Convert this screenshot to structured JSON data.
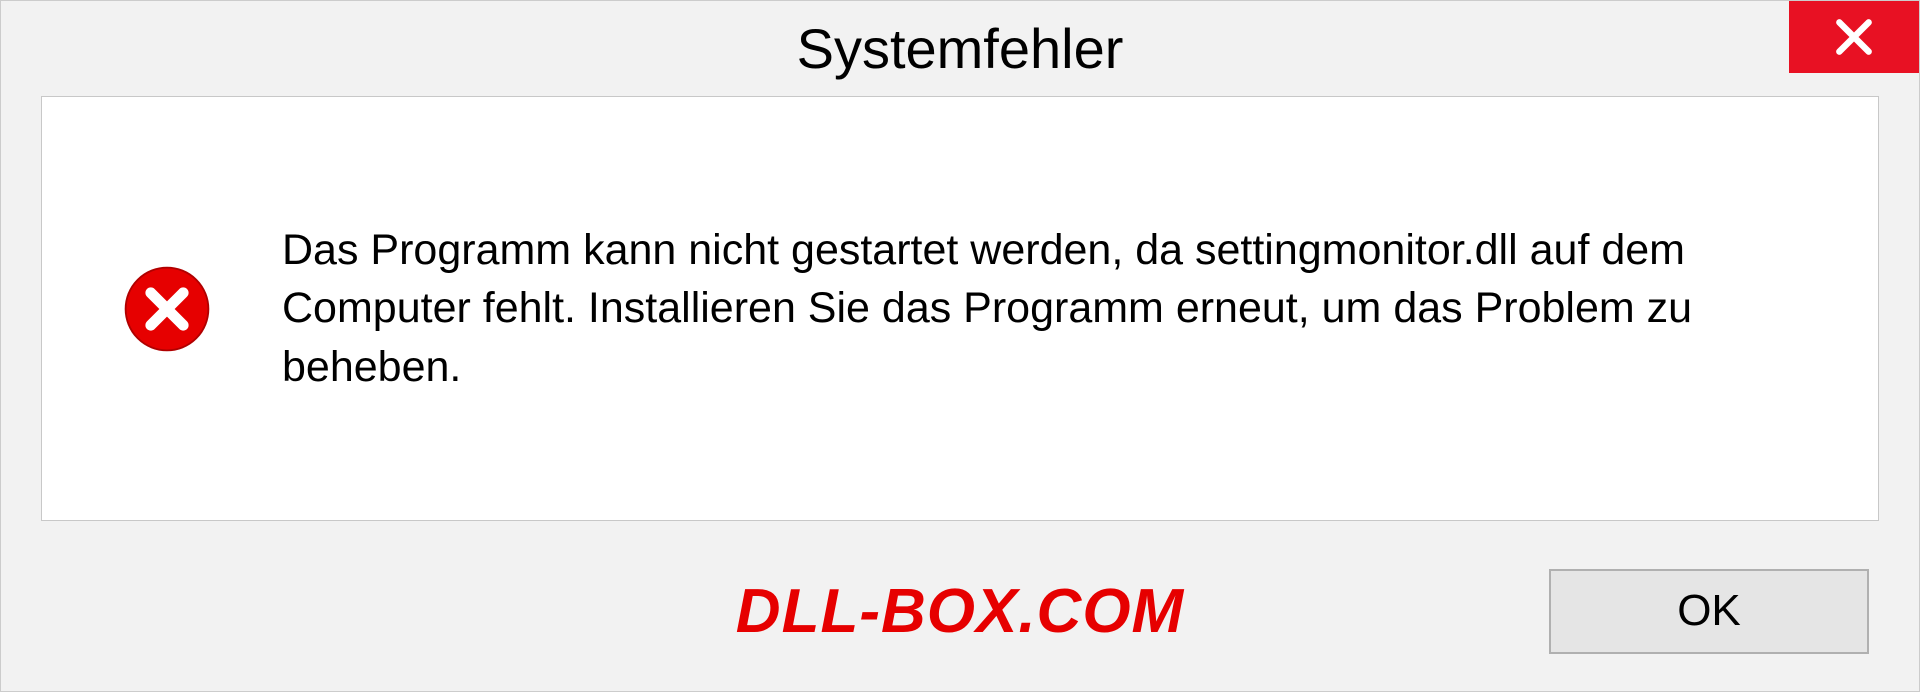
{
  "dialog": {
    "title": "Systemfehler",
    "message": "Das Programm kann nicht gestartet werden, da settingmonitor.dll auf dem Computer fehlt. Installieren Sie das Programm erneut, um das Problem zu beheben.",
    "ok_label": "OK",
    "watermark": "DLL-BOX.COM"
  }
}
